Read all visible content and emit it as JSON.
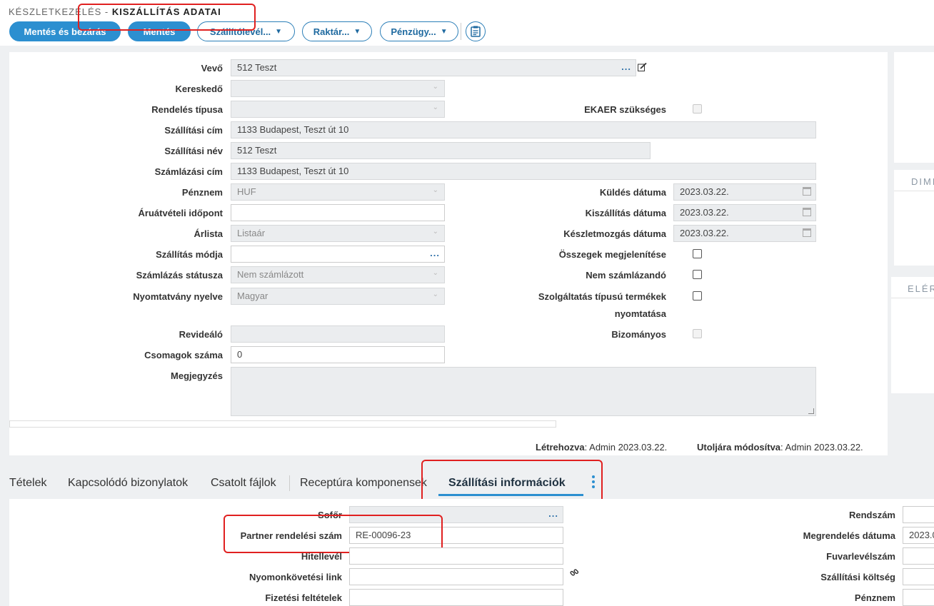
{
  "breadcrumb": {
    "root": "KÉSZLETKEZELÉS -",
    "current": "KISZÁLLÍTÁS ADATAI"
  },
  "toolbar": {
    "save_close": "Mentés és bezárás",
    "save": "Mentés",
    "waybill": "Szállítólevél...",
    "warehouse": "Raktár...",
    "finance": "Pénzügy...",
    "clipboard_icon": "clipboard-icon"
  },
  "form": {
    "vevo": {
      "label": "Vevő",
      "value": "512 Teszt"
    },
    "kereskedo": {
      "label": "Kereskedő",
      "value": ""
    },
    "rendeles_tipusa": {
      "label": "Rendelés típusa",
      "value": ""
    },
    "ekaer": {
      "label": "EKAER szükséges"
    },
    "szallitasi_cim": {
      "label": "Szállítási cím",
      "value": "1133 Budapest, Teszt út 10"
    },
    "szallitasi_nev": {
      "label": "Szállítási név",
      "value": "512 Teszt"
    },
    "szamlazasi_cim": {
      "label": "Számlázási cím",
      "value": "1133 Budapest, Teszt út 10"
    },
    "penznem": {
      "label": "Pénznem",
      "value": "HUF"
    },
    "kuldes_datuma": {
      "label": "Küldés dátuma",
      "value": "2023.03.22."
    },
    "aruatveteli": {
      "label": "Áruátvételi időpont",
      "value": ""
    },
    "kiszallitas_datuma": {
      "label": "Kiszállítás dátuma",
      "value": "2023.03.22."
    },
    "arlista": {
      "label": "Árlista",
      "value": "Listaár"
    },
    "keszletmozgas_datuma": {
      "label": "Készletmozgás dátuma",
      "value": "2023.03.22."
    },
    "szallitas_modja": {
      "label": "Szállítás módja",
      "value": ""
    },
    "osszegek": {
      "label": "Összegek megjelenítése"
    },
    "szamlazas_statusza": {
      "label": "Számlázás státusza",
      "value": "Nem számlázott"
    },
    "nem_szamlazando": {
      "label": "Nem számlázandó"
    },
    "nyomtatvany_nyelve": {
      "label": "Nyomtatvány nyelve",
      "value": "Magyar"
    },
    "szolgaltatas_1": {
      "label": "Szolgáltatás típusú termékek"
    },
    "szolgaltatas_2": {
      "label": "nyomtatása"
    },
    "revidealo": {
      "label": "Revideáló",
      "value": ""
    },
    "bizomanyos": {
      "label": "Bizományos"
    },
    "csomagok": {
      "label": "Csomagok száma",
      "value": "0"
    },
    "megjegyzes": {
      "label": "Megjegyzés",
      "value": ""
    }
  },
  "meta": {
    "created_label": "Létrehozva",
    "created_value": ": Admin 2023.03.22.",
    "modified_label": "Utoljára módosítva",
    "modified_value": ": Admin 2023.03.22."
  },
  "side_panels": {
    "dim": "DIME",
    "eler": "ELÉR"
  },
  "tabs": [
    {
      "label": "Tételek"
    },
    {
      "label": "Kapcsolódó bizonylatok"
    },
    {
      "label": "Csatolt fájlok"
    },
    {
      "label": "Receptúra komponensek"
    },
    {
      "label": "Szállítási információk",
      "active": true
    }
  ],
  "shipping": {
    "sofor": {
      "label": "Sofőr",
      "value": ""
    },
    "partner_rendelesi": {
      "label": "Partner rendelési szám",
      "value": "RE-00096-23"
    },
    "hitellevel": {
      "label": "Hitellevél",
      "value": ""
    },
    "nyomkovetesi": {
      "label": "Nyomonkövetési link",
      "value": ""
    },
    "fizetesi": {
      "label": "Fizetési feltételek",
      "value": ""
    },
    "rendszam": {
      "label": "Rendszám",
      "value": ""
    },
    "megrendeles_datuma": {
      "label": "Megrendelés dátuma",
      "value": "2023.0"
    },
    "fuvarlevelszam": {
      "label": "Fuvarlevélszám",
      "value": ""
    },
    "szallitasi_koltseg": {
      "label": "Szállítási költség",
      "value": ""
    },
    "penznem": {
      "label": "Pénznem",
      "value": ""
    }
  },
  "colors": {
    "accent": "#2c8fd0",
    "highlight": "#e02020"
  }
}
